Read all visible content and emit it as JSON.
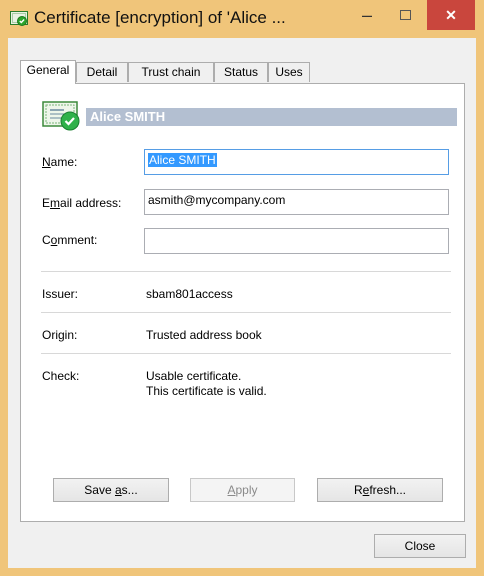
{
  "window": {
    "title": "Certificate [encryption] of 'Alice ...",
    "minimize_symbol": "–",
    "close_symbol": "✕"
  },
  "tabs": [
    {
      "label": "General",
      "active": true
    },
    {
      "label": "Detail"
    },
    {
      "label": "Trust chain"
    },
    {
      "label": "Status"
    },
    {
      "label": "Uses"
    }
  ],
  "certificate": {
    "display_name": "Alice SMITH",
    "icon": "certificate-valid-icon"
  },
  "form": {
    "name_label": "Name:",
    "name_value": "Alice SMITH",
    "email_label": "Email address:",
    "email_value": "asmith@mycompany.com",
    "comment_label": "Comment:",
    "comment_value": ""
  },
  "info": {
    "issuer_label": "Issuer:",
    "issuer_value": "sbam801access",
    "origin_label": "Origin:",
    "origin_value": "Trusted address book",
    "check_label": "Check:",
    "check_line1": "Usable certificate.",
    "check_line2": "This certificate is valid."
  },
  "buttons": {
    "save_as": "Save as...",
    "apply": "Apply",
    "refresh": "Refresh...",
    "close": "Close"
  },
  "colors": {
    "title_bar": "#f0c57a",
    "close_button": "#c9463d",
    "selection": "#3399ff",
    "header_bar": "#b3bfd1"
  }
}
